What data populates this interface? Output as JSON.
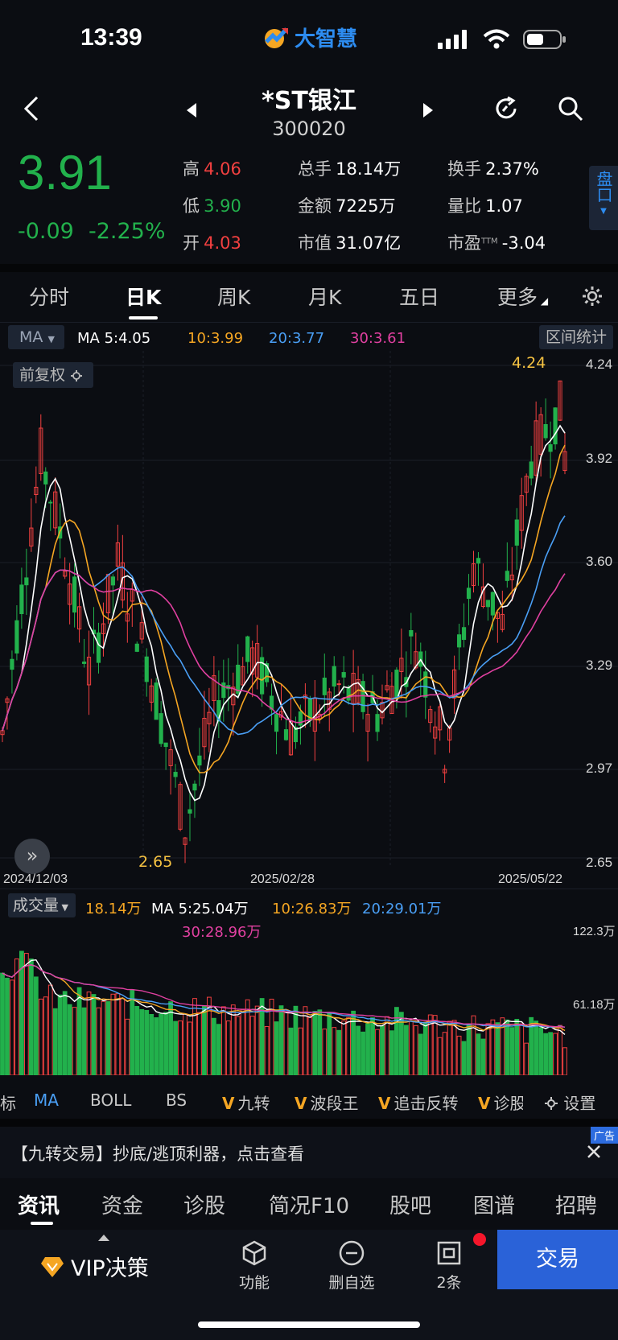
{
  "status": {
    "time": "13:39",
    "app_name": "大智慧"
  },
  "header": {
    "stock_name": "*ST银江",
    "stock_code": "300020"
  },
  "quote": {
    "price": "3.91",
    "change": "-0.09",
    "change_pct": "-2.25%",
    "high_label": "高",
    "high": "4.06",
    "low_label": "低",
    "low": "3.90",
    "open_label": "开",
    "open": "4.03",
    "volume_label": "总手",
    "volume": "18.14万",
    "amount_label": "金额",
    "amount": "7225万",
    "mktcap_label": "市值",
    "mktcap": "31.07亿",
    "turnover_label": "换手",
    "turnover": "2.37%",
    "volratio_label": "量比",
    "volratio": "1.07",
    "pe_label": "市盈",
    "pe_sup": "TTM",
    "pe": "-3.04",
    "pankou_label": "盘口"
  },
  "ktabs": [
    "分时",
    "日K",
    "周K",
    "月K",
    "五日",
    "更多"
  ],
  "indicator": {
    "select": "MA",
    "ma5": "MA 5:4.05",
    "ma10": "10:3.99",
    "ma20": "20:3.77",
    "ma30": "30:3.61",
    "range_btn": "区间统计",
    "fuquan": "前复权"
  },
  "price_axis": [
    "4.24",
    "3.92",
    "3.60",
    "3.29",
    "2.97",
    "2.65"
  ],
  "dates": [
    "2024/12/03",
    "2025/02/28",
    "2025/05/22"
  ],
  "annot": {
    "high": "4.24",
    "low": "2.65"
  },
  "volume_ind": {
    "select": "成交量",
    "vol": "18.14万",
    "ma5": "MA 5:25.04万",
    "ma10": "10:26.83万",
    "ma20": "20:29.01万",
    "ma30": "30:28.96万",
    "axis_top": "122.3万",
    "axis_mid": "61.18万"
  },
  "ind_tabs": {
    "t0": "标",
    "ma": "MA",
    "boll": "BOLL",
    "bs": "BS",
    "jiuzhuan": "九转",
    "boduan": "波段王",
    "zhuiji": "追击反转",
    "zhen": "诊股",
    "settings": "设置"
  },
  "ad": {
    "text": "【九转交易】抄底/逃顶利器，点击查看",
    "tag": "广告"
  },
  "news_tabs": [
    "资讯",
    "资金",
    "诊股",
    "简况F10",
    "股吧",
    "图谱",
    "招聘"
  ],
  "bottom": {
    "vip": "VIP决策",
    "func": "功能",
    "remove": "删自选",
    "alerts": "2条",
    "trade": "交易"
  },
  "colors": {
    "up": "#f24040",
    "down": "#22b14c",
    "ma5": "#ffffff",
    "ma10": "#f5a623",
    "ma20": "#4a9ff5",
    "ma30": "#e040a0",
    "accent": "#2a62d8"
  }
}
